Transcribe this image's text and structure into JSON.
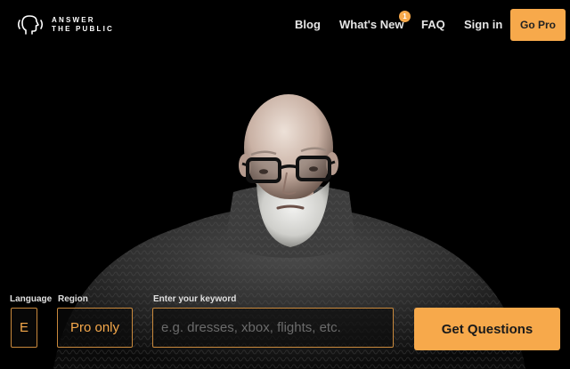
{
  "header": {
    "logo_line1": "ANSWER",
    "logo_line2": "THE PUBLIC",
    "logo_icon": "speaking-head-icon",
    "nav": {
      "blog": "Blog",
      "whats_new": "What's New",
      "whats_new_badge": "1",
      "faq": "FAQ",
      "sign_in": "Sign in"
    },
    "go_pro": "Go Pro"
  },
  "search": {
    "language_label": "Language",
    "language_value": "E",
    "region_label": "Region",
    "region_value": "Pro only",
    "keyword_label": "Enter your keyword",
    "keyword_placeholder": "e.g. dresses, xbox, flights, etc.",
    "keyword_value": "",
    "submit": "Get Questions"
  },
  "colors": {
    "accent": "#f7a94b",
    "background": "#000000",
    "field_border": "#c9893c"
  }
}
